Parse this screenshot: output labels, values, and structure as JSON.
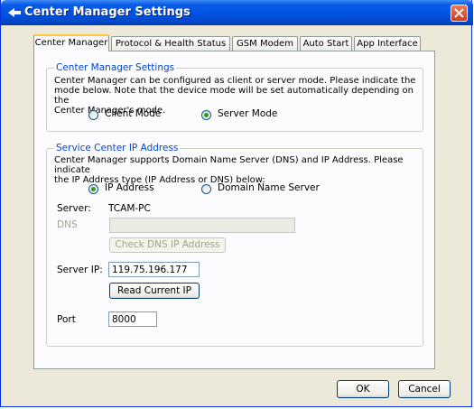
{
  "window": {
    "title": "Center Manager Settings"
  },
  "tabs": [
    {
      "label": "Center Manager"
    },
    {
      "label": "Protocol & Health Status"
    },
    {
      "label": "GSM Modem"
    },
    {
      "label": "Auto Start"
    },
    {
      "label": "App Interface"
    }
  ],
  "settings_group": {
    "legend": "Center Manager Settings",
    "description": [
      "Center Manager can be configured as client or server mode. Please indicate the",
      "mode below. Note that the device mode will be set automatically depending on the",
      "Center Manager's mode."
    ],
    "client_mode_label": "Client Mode",
    "server_mode_label": "Server Mode",
    "selected_mode": "Server Mode"
  },
  "ip_group": {
    "legend": "Service Center IP Address",
    "description": [
      "Center Manager supports Domain Name Server (DNS) and IP Address. Please indicate",
      "the IP Address type (IP Address or DNS) below:"
    ],
    "ip_address_label": "IP Address",
    "dns_option_label": "Domain Name Server",
    "selected_type": "IP Address",
    "server_label": "Server:",
    "server_value": "TCAM-PC",
    "dns_label": "DNS",
    "dns_value": "",
    "check_dns_label": "Check DNS IP Address",
    "server_ip_label": "Server IP:",
    "server_ip_value": "119.75.196.177",
    "read_ip_label": "Read Current IP",
    "port_label": "Port",
    "port_value": "8000"
  },
  "footer": {
    "ok_label": "OK",
    "cancel_label": "Cancel"
  },
  "colors": {
    "titlebar": "#0054e3",
    "legend_text": "#0046d5",
    "radio_dot": "#21a121",
    "dialog_bg": "#ece9d8"
  }
}
